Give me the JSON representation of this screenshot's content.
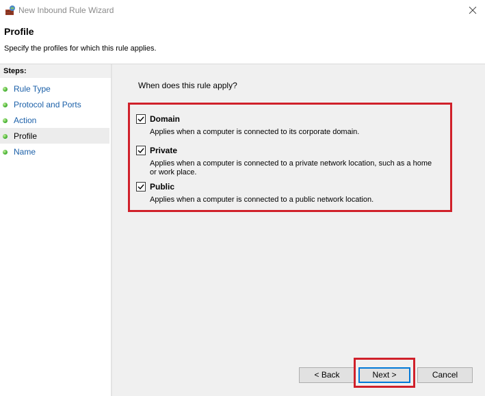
{
  "window": {
    "title": "New Inbound Rule Wizard"
  },
  "header": {
    "title": "Profile",
    "description": "Specify the profiles for which this rule applies."
  },
  "sidebar": {
    "steps_label": "Steps:",
    "items": [
      {
        "label": "Rule Type",
        "current": false
      },
      {
        "label": "Protocol and Ports",
        "current": false
      },
      {
        "label": "Action",
        "current": false
      },
      {
        "label": "Profile",
        "current": true
      },
      {
        "label": "Name",
        "current": false
      }
    ]
  },
  "main": {
    "question": "When does this rule apply?",
    "options": [
      {
        "label": "Domain",
        "checked": true,
        "description": "Applies when a computer is connected to its corporate domain."
      },
      {
        "label": "Private",
        "checked": true,
        "description_line1": "Applies when a computer is connected to a private network location, such as a home",
        "description_line2": "or work place."
      },
      {
        "label": "Public",
        "checked": true,
        "description": "Applies when a computer is connected to a public network location."
      }
    ]
  },
  "buttons": {
    "back": "< Back",
    "next": "Next >",
    "cancel": "Cancel"
  },
  "colors": {
    "highlight": "#d0202a",
    "link": "#1a5fa8",
    "accent": "#0078d7"
  }
}
